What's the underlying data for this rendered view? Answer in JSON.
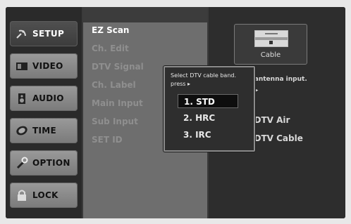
{
  "tabs": [
    {
      "label": "SETUP",
      "icon": "satellite-dish-icon",
      "active": true
    },
    {
      "label": "VIDEO",
      "icon": "tv-icon",
      "active": false
    },
    {
      "label": "AUDIO",
      "icon": "speaker-icon",
      "active": false
    },
    {
      "label": "TIME",
      "icon": "clock-icon",
      "active": false
    },
    {
      "label": "OPTION",
      "icon": "wrench-icon",
      "active": false
    },
    {
      "label": "LOCK",
      "icon": "padlock-icon",
      "active": false
    }
  ],
  "menu": {
    "items": [
      {
        "label": "EZ Scan",
        "selected": true
      },
      {
        "label": "Ch. Edit",
        "selected": false
      },
      {
        "label": "DTV Signal",
        "selected": false
      },
      {
        "label": "Ch. Label",
        "selected": false
      },
      {
        "label": "Main Input",
        "selected": false
      },
      {
        "label": "Sub Input",
        "selected": false
      },
      {
        "label": "SET ID",
        "selected": false
      }
    ]
  },
  "right_panel": {
    "cable_label": "Cable",
    "select_text": "ct antenna input.",
    "press_text": "ss ▸",
    "air_option": "a/DTV Air",
    "cable_option": "a/DTV Cable"
  },
  "popup": {
    "line1": "Select DTV cable band.",
    "line2": "press ▸",
    "options": [
      "1. STD",
      "2. HRC",
      "3. IRC"
    ],
    "selected_index": 0
  }
}
